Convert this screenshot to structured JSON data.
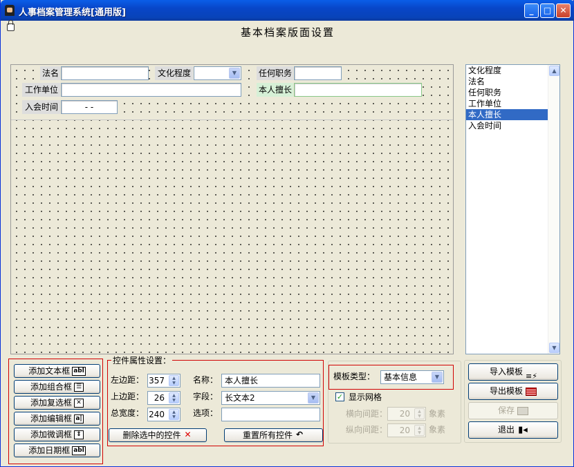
{
  "window": {
    "title": "人事档案管理系统[通用版]"
  },
  "form_title": "基本档案版面设置",
  "fields": {
    "f1": "法名",
    "f2": "文化程度",
    "f3": "任何职务",
    "f4": "工作单位",
    "f5": "本人擅长",
    "f6": "入会时间",
    "date_mask": "-   -"
  },
  "list": {
    "items": [
      "文化程度",
      "法名",
      "任何职务",
      "工作单位",
      "本人擅长",
      "入会时间"
    ],
    "selected": "本人擅长"
  },
  "add_buttons": [
    "添加文本框",
    "添加组合框",
    "添加复选框",
    "添加编辑框",
    "添加微调框",
    "添加日期框"
  ],
  "props": {
    "group_title": "控件属性设置：",
    "left_label": "左边距：",
    "left_value": "357",
    "top_label": "上边距：",
    "top_value": "26",
    "width_label": "总宽度：",
    "width_value": "240",
    "name_label": "名称：",
    "name_value": "本人擅长",
    "field_label": "字段：",
    "field_value": "长文本2",
    "options_label": "选项：",
    "options_value": "",
    "delete_button": "删除选中的控件",
    "reset_button": "重置所有控件"
  },
  "template": {
    "type_label": "模板类型：",
    "type_value": "基本信息",
    "show_grid_label": "显示网格",
    "show_grid_checked": true,
    "h_spacing_label": "横向间距：",
    "h_spacing_value": "20",
    "v_spacing_label": "纵向间距：",
    "v_spacing_value": "20",
    "unit": "象素"
  },
  "actions": {
    "import": "导入模板",
    "export": "导出模板",
    "save": "保存",
    "exit": "退出"
  }
}
